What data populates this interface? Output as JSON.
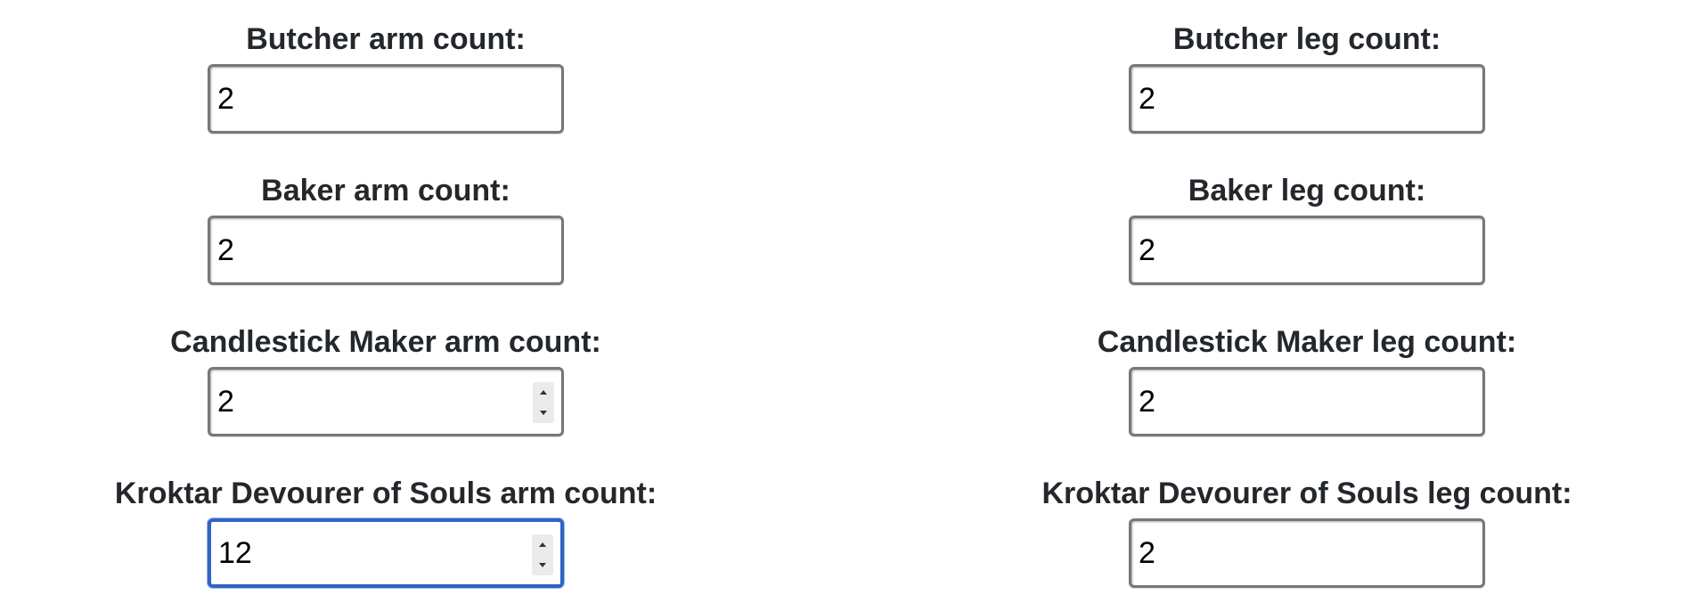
{
  "arms": {
    "butcher": {
      "label": "Butcher arm count:",
      "value": "2"
    },
    "baker": {
      "label": "Baker arm count:",
      "value": "2"
    },
    "candlestick_maker": {
      "label": "Candlestick Maker arm count:",
      "value": "2"
    },
    "kroktar": {
      "label": "Kroktar Devourer of Souls arm count:",
      "value": "12"
    }
  },
  "legs": {
    "butcher": {
      "label": "Butcher leg count:",
      "value": "2"
    },
    "baker": {
      "label": "Baker leg count:",
      "value": "2"
    },
    "candlestick_maker": {
      "label": "Candlestick Maker leg count:",
      "value": "2"
    },
    "kroktar": {
      "label": "Kroktar Devourer of Souls leg count:",
      "value": "2"
    }
  },
  "colors": {
    "focus_border": "#2f64c3",
    "input_border": "#777777",
    "label_text": "#24282c"
  },
  "icons": {
    "stepper_up": "chevron-up-icon",
    "stepper_down": "chevron-down-icon"
  }
}
